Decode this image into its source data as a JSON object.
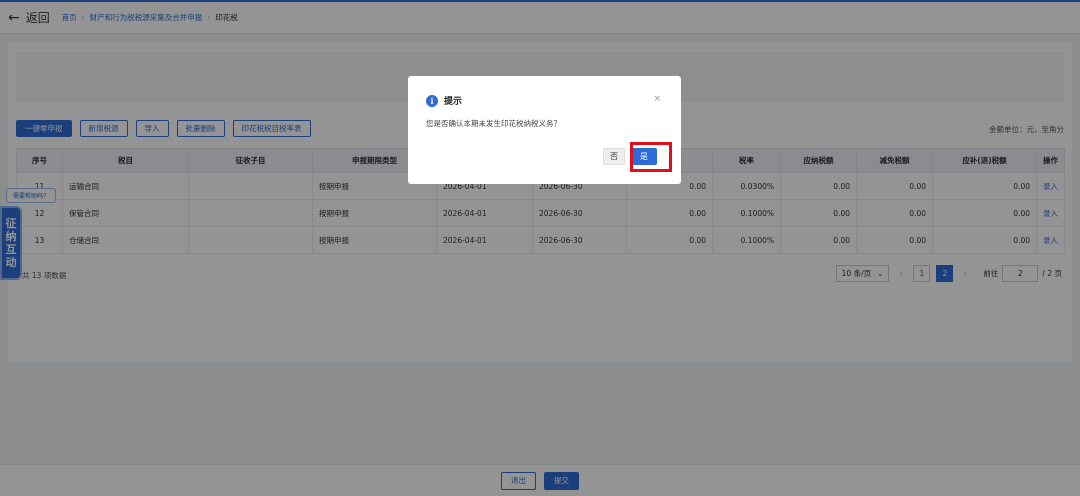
{
  "header": {
    "back_label": "返回",
    "breadcrumb": [
      "首页",
      "财产和行为税税源采集及合并申报",
      "印花税"
    ]
  },
  "toolbar": {
    "buttons": [
      "一键零申报",
      "新增税源",
      "导入",
      "批量删除",
      "印花税税目税率表"
    ]
  },
  "unit_text": "金额单位：元，至角分",
  "table": {
    "columns": [
      "序号",
      "税目",
      "征收子目",
      "申报期限类型",
      "",
      "",
      "",
      "税率",
      "应纳税额",
      "减免税额",
      "应补(退)税额",
      "操作"
    ],
    "rows": [
      {
        "no": "11",
        "item": "运输合同",
        "sub": "",
        "period_type": "按期申报",
        "start": "2026-04-01",
        "end": "2026-06-30",
        "amount": "0.00",
        "rate": "0.0300%",
        "tax": "0.00",
        "relief": "0.00",
        "payable": "0.00",
        "action": "录入"
      },
      {
        "no": "12",
        "item": "保管合同",
        "sub": "",
        "period_type": "按期申报",
        "start": "2026-04-01",
        "end": "2026-06-30",
        "amount": "0.00",
        "rate": "0.1000%",
        "tax": "0.00",
        "relief": "0.00",
        "payable": "0.00",
        "action": "录入"
      },
      {
        "no": "13",
        "item": "仓储合同",
        "sub": "",
        "period_type": "按期申报",
        "start": "2026-04-01",
        "end": "2026-06-30",
        "amount": "0.00",
        "rate": "0.1000%",
        "tax": "0.00",
        "relief": "0.00",
        "payable": "0.00",
        "action": "录入"
      }
    ]
  },
  "total_text": "共 13 项数据",
  "pager": {
    "page_size": "10 条/页",
    "pages": [
      "1",
      "2"
    ],
    "current": "2",
    "goto_label": "前往",
    "goto_value": "2",
    "total_pages": "/ 2 页"
  },
  "float_tab": {
    "chars": [
      "征",
      "纳",
      "互",
      "动"
    ],
    "bubble": "需要帮助吗？"
  },
  "footer": {
    "exit_label": "退出",
    "submit_label": "提交"
  },
  "modal": {
    "title": "提示",
    "message": "您是否确认本期未发生印花税纳税义务？",
    "no_label": "否",
    "yes_label": "是",
    "close": "×"
  },
  "colors": {
    "accent": "#2f6bd8",
    "highlight": "#e0101a"
  }
}
